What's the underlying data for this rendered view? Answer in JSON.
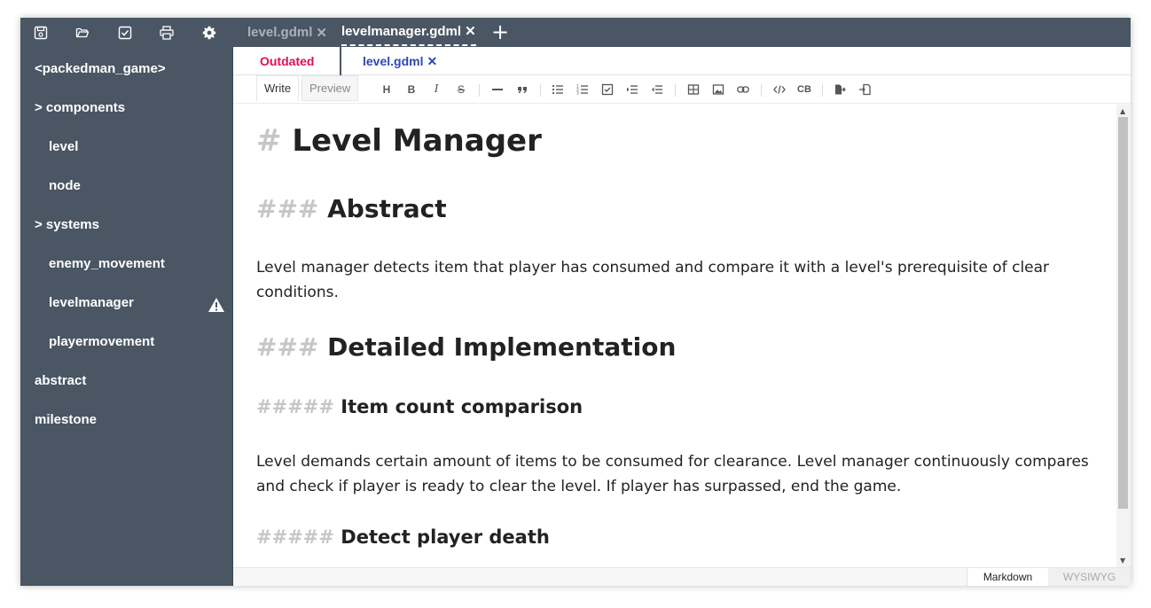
{
  "titlebar": {
    "icons": [
      "save-icon",
      "open-folder-icon",
      "checkbox-icon",
      "print-icon",
      "settings-gear-icon"
    ],
    "tabs": [
      {
        "label": "level.gdml",
        "close": "✕",
        "active": false
      },
      {
        "label": "levelmanager.gdml",
        "close": "✕",
        "active": true
      }
    ],
    "add_tab": "+"
  },
  "sidebar": {
    "items": [
      {
        "label": "<packedman_game>"
      },
      {
        "label": "> components"
      },
      {
        "label": "level"
      },
      {
        "label": "node"
      },
      {
        "label": "> systems"
      },
      {
        "label": "enemy_movement"
      },
      {
        "label": "levelmanager",
        "status_icon": "warning-icon"
      },
      {
        "label": "playermovement"
      },
      {
        "label": "abstract"
      },
      {
        "label": "milestone"
      }
    ]
  },
  "subtabs": {
    "status": "Outdated",
    "file": "level.gdml",
    "file_close": "✕",
    "status_color": "#e0104f",
    "file_color": "#2e46b6"
  },
  "toolbar": {
    "write": "Write",
    "preview": "Preview",
    "heading": "H",
    "bold": "B",
    "italic": "I",
    "strike": "S",
    "code_block": "CB",
    "icons": [
      "heading-icon",
      "bold-icon",
      "italic-icon",
      "strike-icon",
      "hr-icon",
      "quote-icon",
      "bullet-list-icon",
      "ordered-list-icon",
      "task-list-icon",
      "indent-icon",
      "outdent-icon",
      "table-icon",
      "image-icon",
      "link-icon",
      "code-icon",
      "code-block-icon",
      "export-icon",
      "import-icon"
    ]
  },
  "document": {
    "h1": {
      "hash": "#",
      "text": "Level Manager"
    },
    "h3_abstract": {
      "hash": "###",
      "text": "Abstract"
    },
    "p_abstract": "Level manager detects item that player has consumed and compare it with a level's prerequisite of clear conditions.",
    "h3_impl": {
      "hash": "###",
      "text": "Detailed Implementation"
    },
    "h5_item": {
      "hash": "#####",
      "text": "Item count comparison"
    },
    "p_item": "Level demands certain amount of items to be consumed for clearance. Level manager continuously compares and check if player is ready to clear the level. If player has surpassed, end the game.",
    "h5_death": {
      "hash": "#####",
      "text": "Detect player death"
    }
  },
  "statusbar": {
    "markdown": "Markdown",
    "wysiwyg": "WYSIWYG",
    "active_mode": "Markdown"
  },
  "colors": {
    "sidebar_bg": "#4a5664",
    "accent_red": "#e0104f",
    "accent_blue": "#2e46b6",
    "hash_gray": "#c6c6c6"
  }
}
